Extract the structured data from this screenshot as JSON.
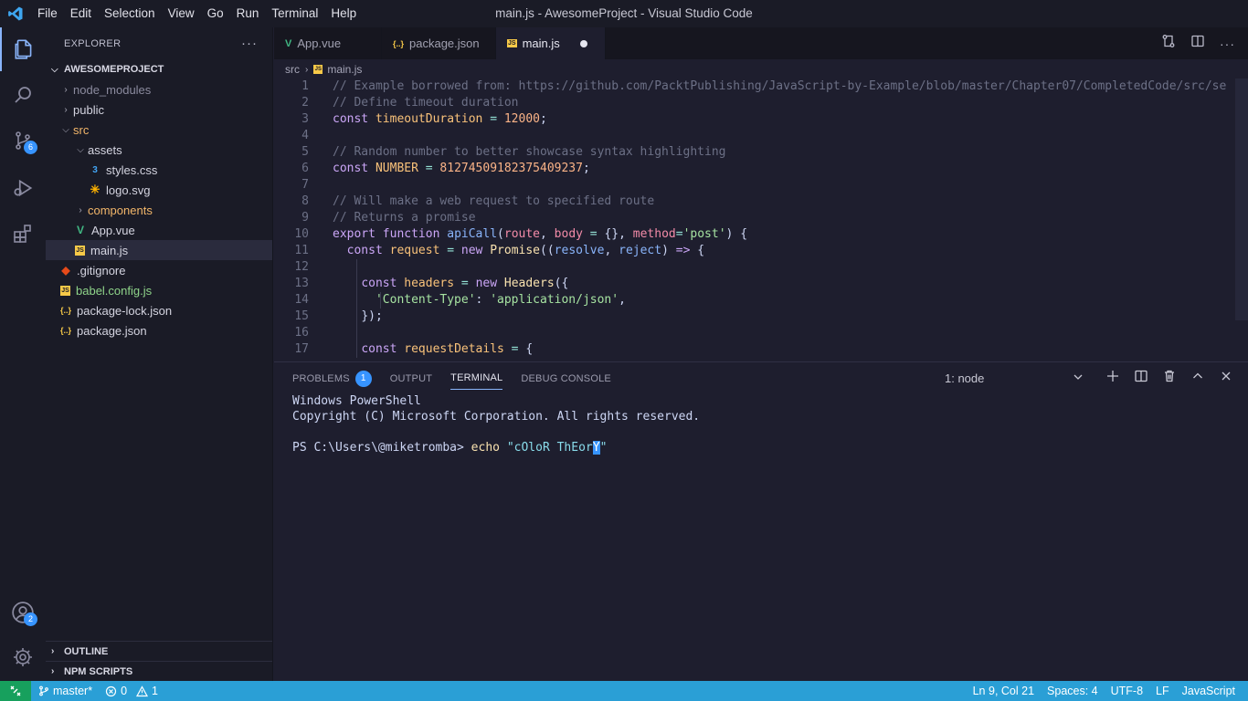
{
  "window": {
    "title": "main.js - AwesomeProject - Visual Studio Code"
  },
  "menu": [
    "File",
    "Edit",
    "Selection",
    "View",
    "Go",
    "Run",
    "Terminal",
    "Help"
  ],
  "activity": {
    "scm_badge": "6",
    "accounts_badge": "2"
  },
  "sidebar": {
    "header": "EXPLORER",
    "more": "···",
    "project": "AWESOMEPROJECT",
    "tree": [
      {
        "label": "node_modules",
        "color": "#8b8b9e"
      },
      {
        "label": "public",
        "color": "#d4d4e0"
      },
      {
        "label": "src",
        "color": "#f2b66a"
      },
      {
        "label": "assets",
        "color": "#d4d4e0"
      },
      {
        "label": "styles.css",
        "color": "#d4d4e0"
      },
      {
        "label": "logo.svg",
        "color": "#d4d4e0"
      },
      {
        "label": "components",
        "color": "#f2b66a"
      },
      {
        "label": "App.vue",
        "color": "#d4d4e0"
      },
      {
        "label": "main.js",
        "color": "#d4d4e0"
      },
      {
        "label": ".gitignore",
        "color": "#d4d4e0"
      },
      {
        "label": "babel.config.js",
        "color": "#8fd48a"
      },
      {
        "label": "package-lock.json",
        "color": "#d4d4e0"
      },
      {
        "label": "package.json",
        "color": "#d4d4e0"
      }
    ],
    "outline": "OUTLINE",
    "npm_scripts": "NPM SCRIPTS"
  },
  "tabs": [
    {
      "label": "App.vue"
    },
    {
      "label": "package.json"
    },
    {
      "label": "main.js"
    }
  ],
  "breadcrumb": {
    "folder": "src",
    "file": "main.js"
  },
  "editor": {
    "lines": [
      "1",
      "2",
      "3",
      "4",
      "5",
      "6",
      "7",
      "8",
      "9",
      "10",
      "11",
      "12",
      "13",
      "14",
      "15",
      "16",
      "17"
    ],
    "code": {
      "l1": "// Example borrowed from: https://github.com/PacktPublishing/JavaScript-by-Example/blob/master/Chapter07/CompletedCode/src/se",
      "l2": "// Define timeout duration",
      "l5": "// Random number to better showcase syntax highlighting",
      "l8": "// Will make a web request to specified route",
      "l9": "// Returns a promise",
      "const": "const",
      "timeoutDuration": "timeoutDuration",
      "eq": " = ",
      "n12000": "12000",
      "semi": ";",
      "NUMBER": "NUMBER",
      "bignum": "812745091823754092 37",
      "bignum_text": "81274509182375409237",
      "export": "export",
      "function": "function",
      "apiCall": "apiCall",
      "route": "route",
      "body": "body",
      "method": "method",
      "post": "'post'",
      "request": "request",
      "new": "new",
      "Promise": "Promise",
      "resolve": "resolve",
      "reject": "reject",
      "arrow": "=>",
      "headers": "headers",
      "Headers": "Headers",
      "content_type": "'Content-Type'",
      "app_json": "'application/json'",
      "requestDetails": "requestDetails"
    }
  },
  "panel": {
    "tabs": {
      "problems": "PROBLEMS",
      "problems_count": "1",
      "output": "OUTPUT",
      "terminal": "TERMINAL",
      "debug": "DEBUG CONSOLE"
    },
    "terminal_select": "1: node",
    "terminal_lines": {
      "l1": "Windows PowerShell",
      "l2": "Copyright (C) Microsoft Corporation. All rights reserved.",
      "prompt": "PS C:\\Users\\@miketromba> ",
      "cmd": "echo",
      "arg_open": "\"cOloR ThEor",
      "arg_cursor": "Y",
      "arg_close": "\""
    }
  },
  "status": {
    "branch": "master*",
    "errors": "0",
    "warnings": "1",
    "position": "Ln 9, Col 21",
    "spaces": "Spaces: 4",
    "encoding": "UTF-8",
    "eol": "LF",
    "language": "JavaScript"
  }
}
